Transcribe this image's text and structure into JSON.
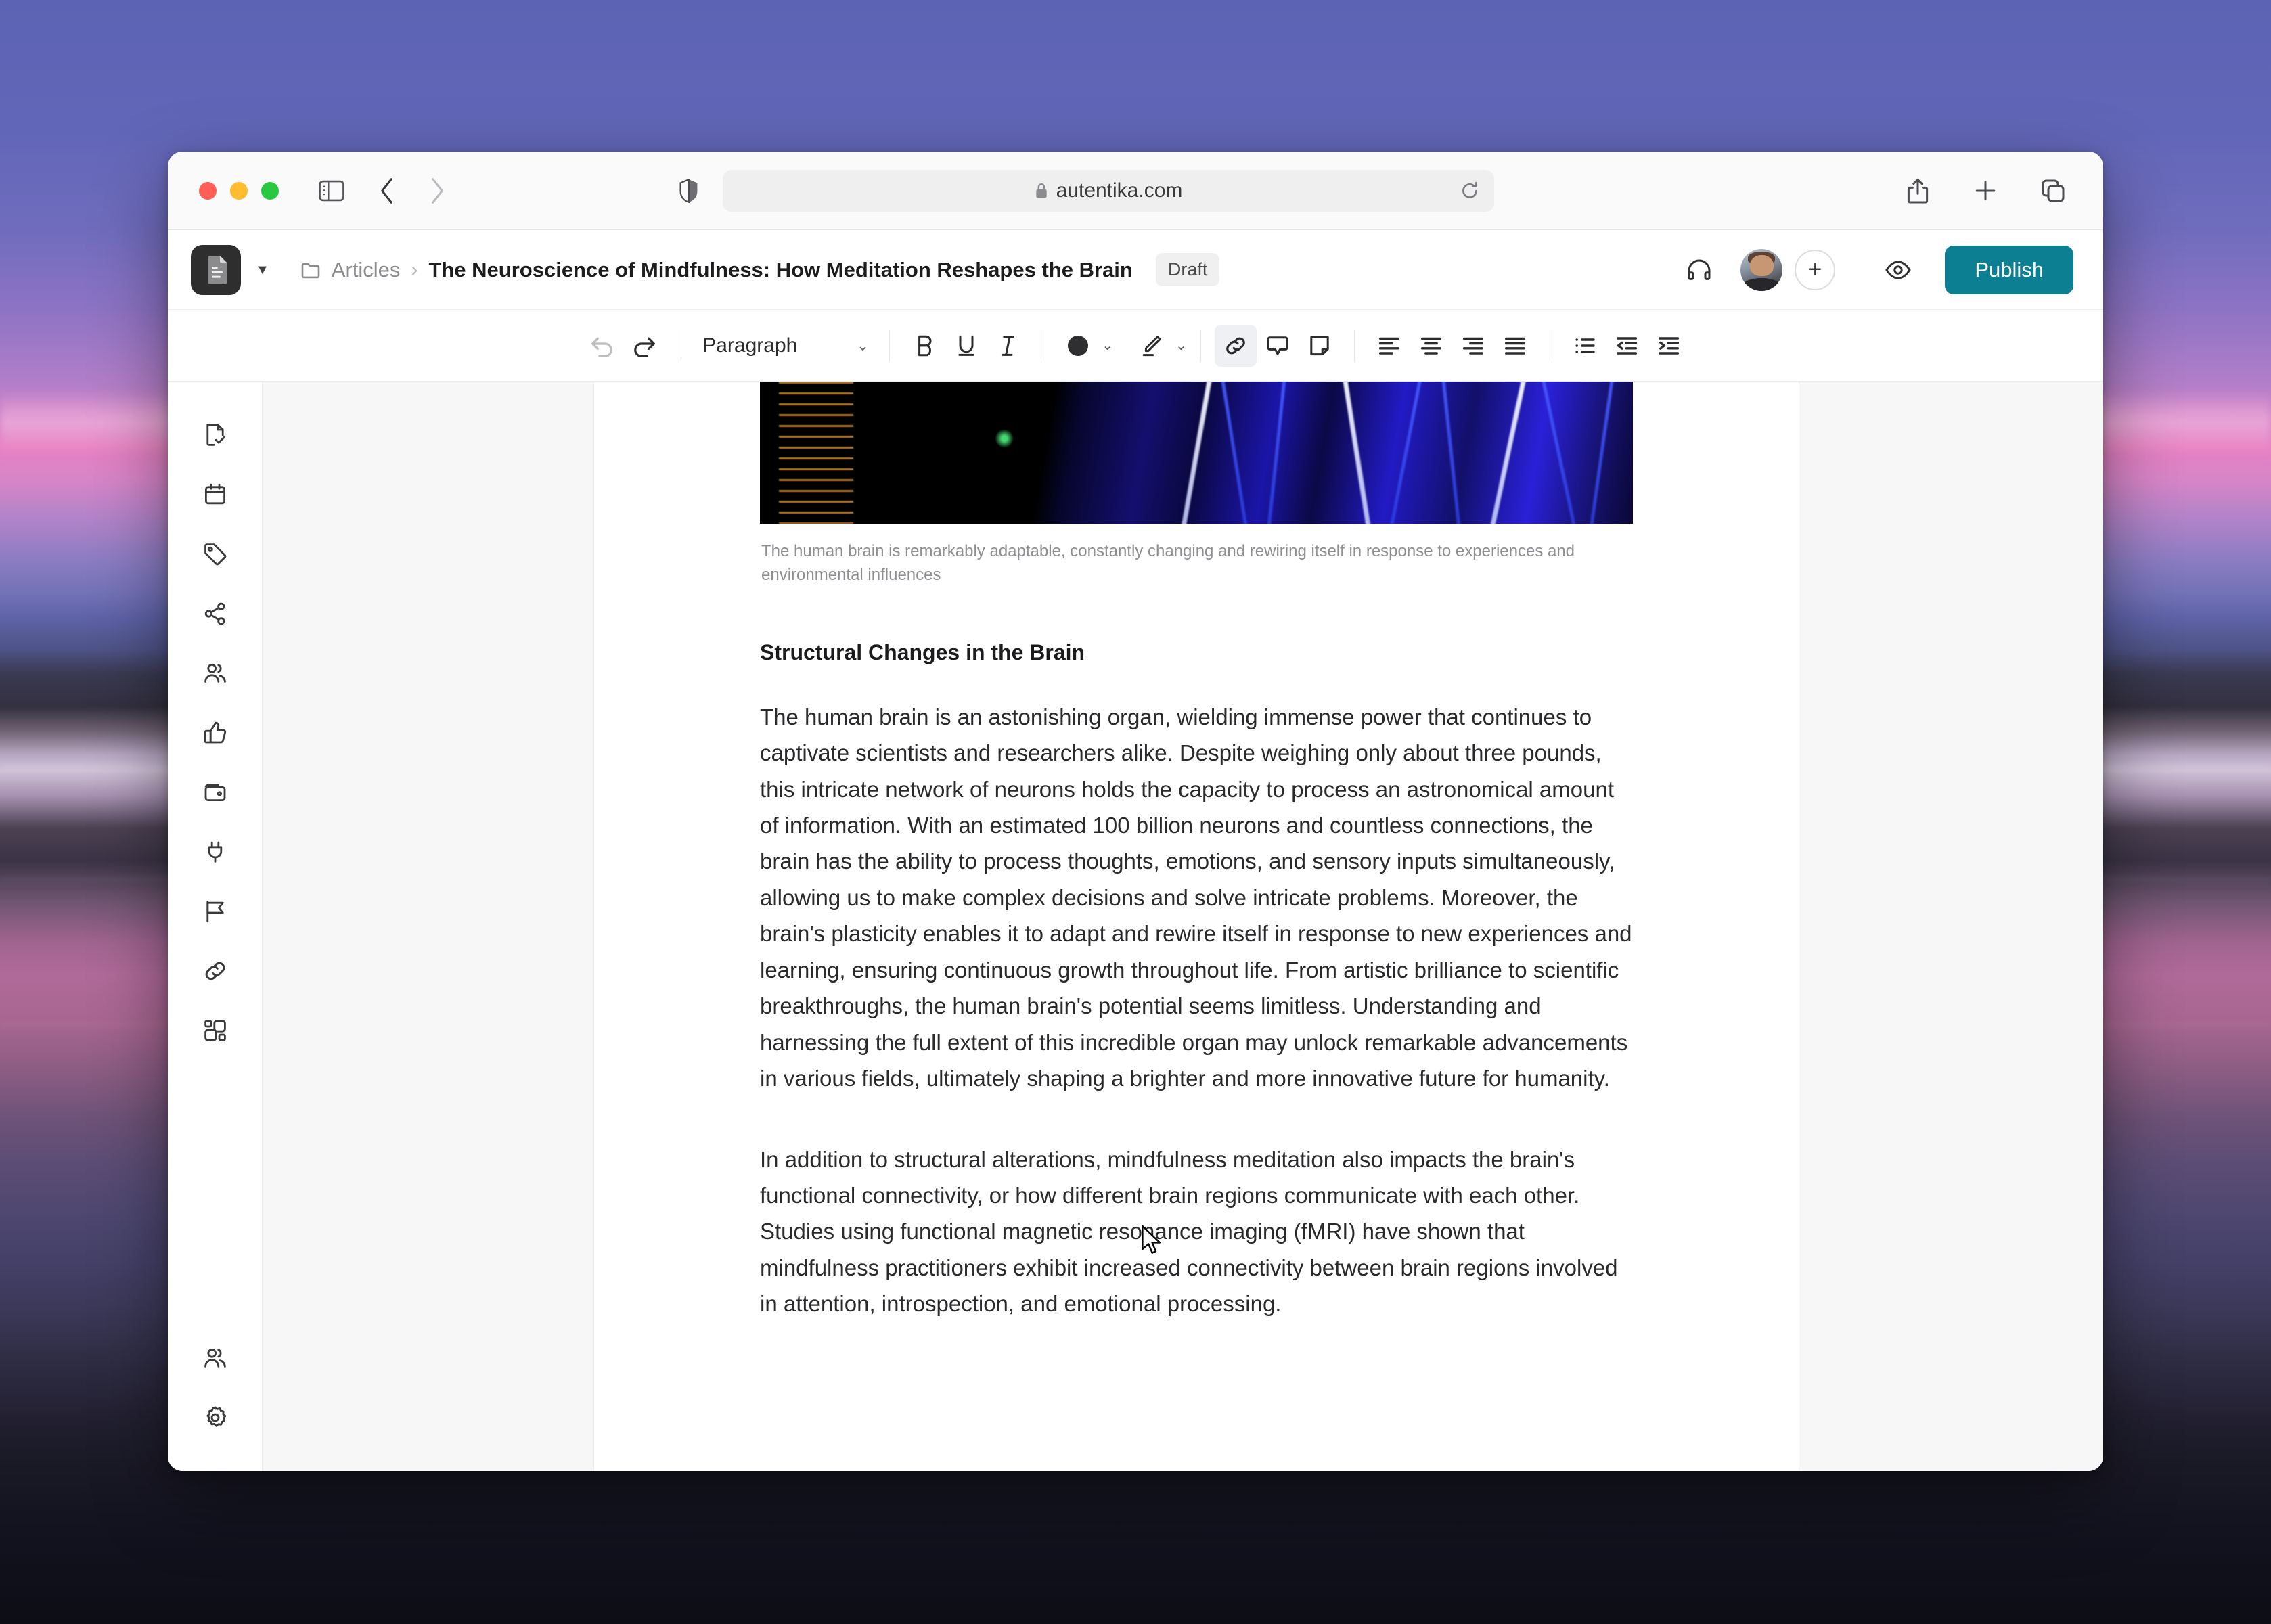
{
  "browser": {
    "url": "autentika.com",
    "lock_icon": "lock-icon",
    "reload_icon": "reload-icon",
    "back_icon": "chevron-left-icon",
    "forward_icon": "chevron-right-icon",
    "sidebar_icon": "sidebar-toggle-icon",
    "shield_icon": "privacy-shield-icon",
    "share_icon": "share-icon",
    "new_tab_icon": "plus-icon",
    "tabs_icon": "tab-overview-icon",
    "traffic_lights": [
      "close-red",
      "minimize-yellow",
      "maximize-green"
    ]
  },
  "header": {
    "logo_icon": "document-app-logo",
    "workspace_caret": "▼",
    "folder_icon": "folder-icon",
    "breadcrumb_parent": "Articles",
    "breadcrumb_separator": "›",
    "document_title": "The Neuroscience of Mindfulness: How Meditation Reshapes the Brain",
    "status_badge": "Draft",
    "headphones_icon": "headphones-icon",
    "avatar": "user-avatar",
    "add_collaborator_icon": "+",
    "preview_icon": "eye-preview-icon",
    "publish_label": "Publish",
    "publish_color": "#0d7f92"
  },
  "toolbar": {
    "undo_icon": "undo-icon",
    "redo_icon": "redo-icon",
    "block_type": "Paragraph",
    "block_caret": "⌄",
    "bold_label": "B",
    "underline_label": "U",
    "italic_label": "I",
    "text_color": "#2f2f31",
    "color_caret": "⌄",
    "highlighter_icon": "highlighter-pen-icon",
    "highlighter_caret": "⌄",
    "link_icon": "link-icon",
    "comment_icon": "comment-bubble-icon",
    "note_icon": "sticky-note-icon",
    "align_left_icon": "align-left-icon",
    "align_center_icon": "align-center-icon",
    "align_right_icon": "align-right-icon",
    "align_justify_icon": "align-justify-icon",
    "bullet_list_icon": "bullet-list-icon",
    "outdent_icon": "outdent-icon",
    "indent_icon": "indent-icon"
  },
  "sidebar": {
    "items": [
      {
        "icon": "document-check-icon",
        "name": "tasks"
      },
      {
        "icon": "calendar-icon",
        "name": "calendar"
      },
      {
        "icon": "tag-icon",
        "name": "tags"
      },
      {
        "icon": "share-nodes-icon",
        "name": "share"
      },
      {
        "icon": "users-icon",
        "name": "team"
      },
      {
        "icon": "thumbs-up-icon",
        "name": "approvals"
      },
      {
        "icon": "wallet-icon",
        "name": "billing"
      },
      {
        "icon": "plug-icon",
        "name": "integrations"
      },
      {
        "icon": "flag-icon",
        "name": "goals"
      },
      {
        "icon": "link-chain-icon",
        "name": "links"
      },
      {
        "icon": "apps-grid-icon",
        "name": "apps"
      }
    ],
    "bottom_items": [
      {
        "icon": "users-icon",
        "name": "members"
      },
      {
        "icon": "gear-icon",
        "name": "settings"
      }
    ]
  },
  "document": {
    "image_caption": "The human brain is remarkably adaptable, constantly changing and rewiring itself in response to experiences and environmental influences",
    "heading": "Structural Changes in the Brain",
    "paragraph_1": "The human brain is an astonishing organ, wielding immense power that continues to captivate scientists and researchers alike. Despite weighing only about three pounds, this intricate network of neurons holds the capacity to process an astronomical amount of information. With an estimated 100 billion neurons and countless connections, the brain has the ability to process thoughts, emotions, and sensory inputs simultaneously, allowing us to make complex decisions and solve intricate problems. Moreover, the brain's plasticity enables it to adapt and rewire itself in response to new experiences and learning, ensuring continuous growth throughout life. From artistic brilliance to scientific breakthroughs, the human brain's potential seems limitless. Understanding and harnessing the full extent of this incredible organ may unlock remarkable advancements in various fields, ultimately shaping a brighter and more innovative future for humanity.",
    "paragraph_2": "In addition to structural alterations, mindfulness meditation also impacts the brain's functional connectivity, or how different brain regions communicate with each other. Studies using functional magnetic resonance imaging (fMRI) have shown that mindfulness practitioners exhibit increased connectivity between brain regions involved in attention, introspection, and emotional processing."
  }
}
